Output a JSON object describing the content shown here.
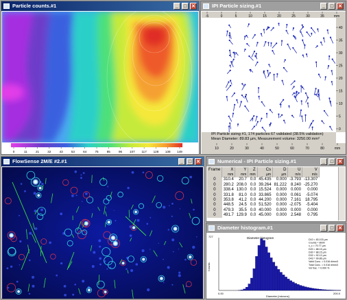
{
  "windows": {
    "counts": {
      "title": "Particle counts.#1",
      "legend": [
        "0",
        "11",
        "21",
        "32",
        "43",
        "53",
        "64",
        "75",
        "85",
        "96",
        "107",
        "117",
        "128",
        "138",
        "149"
      ]
    },
    "sizing": {
      "title": "IPI Particle sizing.#1",
      "caption1": "IPI Particle sizing #1, 174 particles 67 validated (38.5% validation)",
      "caption2": "Mean Diameter: 89.83 µm,  Measurement volume: 3250.00 mm³",
      "ruler_top": [
        "-5",
        "0",
        "5",
        "10",
        "15",
        "20",
        "25",
        "30",
        "35",
        "mm"
      ],
      "ruler_bottom": [
        "10",
        "20",
        "30",
        "40",
        "50",
        "60",
        "70",
        "80",
        "mm"
      ],
      "ruler_right": [
        "40",
        "35",
        "30",
        "25",
        "20",
        "15",
        "10",
        "5",
        "0"
      ]
    },
    "flow": {
      "title": "FlowSense 2M/E #2.#1"
    },
    "numerical": {
      "title": "Numerical - IPI Particle sizing.#1",
      "columns": [
        "Frame",
        "X",
        "Y",
        "Z",
        "Cs",
        "D",
        "U",
        "V"
      ],
      "units": [
        "",
        "mm",
        "mm",
        "mm",
        "µm",
        "µm",
        "m/s",
        "m/s"
      ],
      "rows": [
        [
          "0",
          "310.4",
          "20.7",
          "0.0",
          "45.435",
          "0.000",
          "-3.793",
          "-13.307"
        ],
        [
          "0",
          "280.2",
          "208.0",
          "0.0",
          "39.264",
          "81.222",
          "8.240",
          "-25.270"
        ],
        [
          "0",
          "338.4",
          "130.0",
          "0.0",
          "15.524",
          "0.000",
          "0.000",
          "0.000"
        ],
        [
          "0",
          "331.8",
          "81.0",
          "0.0",
          "33.865",
          "0.000",
          "0.061",
          "-5.074"
        ],
        [
          "0",
          "353.8",
          "41.2",
          "0.0",
          "44.200",
          "0.000",
          "7.161",
          "18.795"
        ],
        [
          "0",
          "448.5",
          "24.5",
          "0.0",
          "51.520",
          "0.000",
          "-2.075",
          "-5.404"
        ],
        [
          "0",
          "479.3",
          "35.5",
          "0.0",
          "40.000",
          "0.000",
          "0.000",
          "0.000"
        ],
        [
          "0",
          "491.7",
          "129.9",
          "0.0",
          "45.000",
          "0.000",
          "2.548",
          "0.795"
        ]
      ]
    },
    "histogram": {
      "title": "Diameter histogram.#1",
      "chart_title": "Diameter histogram",
      "xlabel": "Diameter [microns]",
      "ylabel": "Counts",
      "ymax_label": "727",
      "x0_label": "0.00",
      "x1_label": "200.0",
      "stats": [
        "D10 = 83.103 µm",
        "Counts = 8009",
        "x_c = 70.77 µm",
        "D20 = 88.15 µm",
        "D30 = 88.15 µm",
        "D32 = 92.12 µm",
        "D43 = 99.86 µm",
        "Valid Conc. = 0.016 #/mm3",
        "Total Conc. = 0.016 #/mm3",
        "Vol frac. = 0.000 %"
      ]
    }
  },
  "chart_data": {
    "type": "bar",
    "title": "Diameter histogram",
    "xlabel": "Diameter [microns]",
    "ylabel": "Counts",
    "xlim": [
      0,
      200
    ],
    "ylim": [
      0,
      727
    ],
    "bin_width": 4,
    "x": [
      2,
      6,
      10,
      14,
      18,
      22,
      26,
      30,
      34,
      38,
      42,
      46,
      50,
      54,
      58,
      62,
      66,
      70,
      74,
      78,
      82,
      86,
      90,
      94,
      98,
      102,
      106,
      110,
      114,
      118,
      122,
      126,
      130,
      134,
      138,
      142,
      146,
      150,
      154,
      158,
      162,
      166,
      170,
      174,
      178,
      182,
      186,
      190,
      194,
      198
    ],
    "values": [
      0,
      0,
      0,
      0,
      0,
      0,
      0,
      0,
      2,
      8,
      20,
      45,
      90,
      170,
      300,
      470,
      620,
      715,
      690,
      600,
      520,
      450,
      390,
      335,
      290,
      250,
      215,
      185,
      158,
      135,
      115,
      98,
      83,
      70,
      60,
      50,
      42,
      35,
      29,
      24,
      20,
      16,
      13,
      10,
      8,
      6,
      5,
      4,
      3,
      2
    ]
  }
}
